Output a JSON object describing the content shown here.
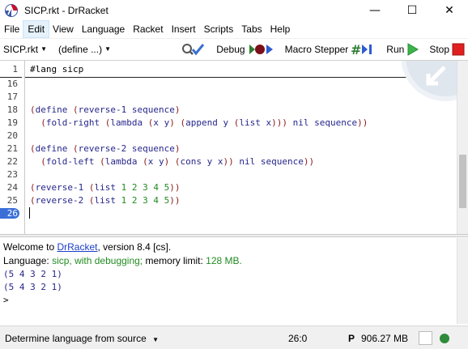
{
  "window": {
    "title": "SICP.rkt - DrRacket",
    "minimize_glyph": "—",
    "maximize_glyph": "☐",
    "close_glyph": "✕"
  },
  "menu": {
    "items": [
      "File",
      "Edit",
      "View",
      "Language",
      "Racket",
      "Insert",
      "Scripts",
      "Tabs",
      "Help"
    ],
    "active": "Edit"
  },
  "toolbar": {
    "file_dropdown": "SICP.rkt",
    "define_dropdown": "(define ...)",
    "debug_label": "Debug",
    "macro_stepper_label": "Macro Stepper",
    "run_label": "Run",
    "stop_label": "Stop"
  },
  "editor": {
    "fixed_line_number": "1",
    "fixed_line_text": "#lang sicp",
    "line_numbers": [
      "16",
      "17",
      "18",
      "19",
      "20",
      "21",
      "22",
      "23",
      "24",
      "25",
      "26"
    ],
    "current_line": "26",
    "code": {
      "l18": "(define (reverse-1 sequence)",
      "l19": "  (fold-right (lambda (x y) (append y (list x))) nil sequence))",
      "l21": "(define (reverse-2 sequence)",
      "l22": "  (fold-left (lambda (x y) (cons y x)) nil sequence))",
      "l24": "(reverse-1 (list 1 2 3 4 5))",
      "l25": "(reverse-2 (list 1 2 3 4 5))"
    }
  },
  "interactions": {
    "welcome_prefix": "Welcome to ",
    "welcome_link": "DrRacket",
    "welcome_suffix": ", version 8.4 [cs].",
    "language_prefix": "Language: ",
    "language_value": "sicp, with debugging;",
    "memory_prefix": " memory limit: ",
    "memory_value": "128 MB.",
    "output_1": "(5 4 3 2 1)",
    "output_2": "(5 4 3 2 1)",
    "prompt": ">"
  },
  "status": {
    "language_label": "Determine language from source",
    "position": "26:0",
    "p_indicator": "P",
    "memory": "906.27 MB"
  },
  "colors": {
    "paren": "#8b1a1a",
    "keyword": "#26268c",
    "number": "#228b22",
    "current_line_bg": "#3a6fd8",
    "link": "#1a3ec8"
  }
}
